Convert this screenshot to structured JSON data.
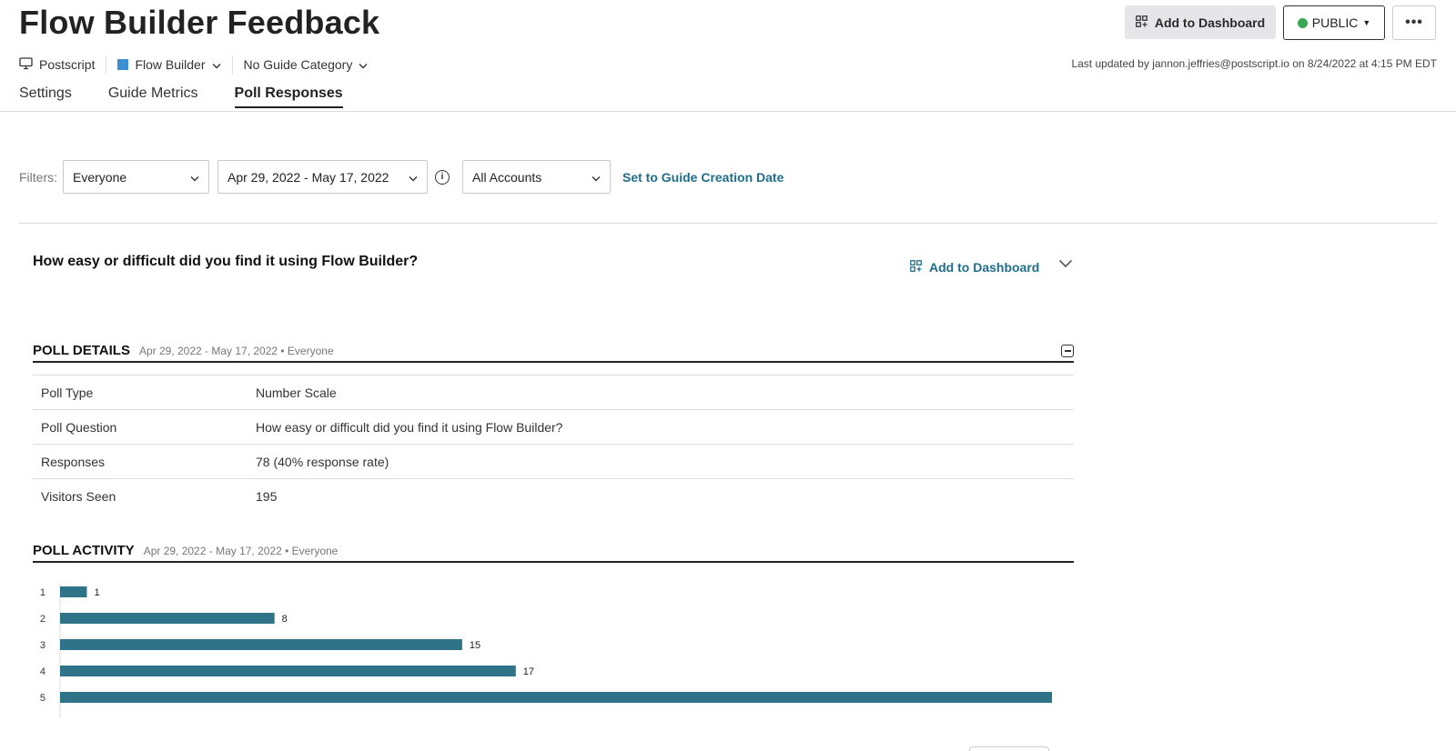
{
  "header": {
    "title": "Flow Builder Feedback",
    "add_dashboard_label": "Add to Dashboard",
    "public_label": "PUBLIC",
    "more_label": "•••",
    "status_color": "#3aa757"
  },
  "meta": {
    "app_label": "Postscript",
    "product_label": "Flow Builder",
    "product_color": "#3b8fd1",
    "category_label": "No Guide Category",
    "last_updated": "Last updated by jannon.jeffries@postscript.io on 8/24/2022 at 4:15 PM EDT"
  },
  "tabs": [
    {
      "label": "Settings",
      "active": false
    },
    {
      "label": "Guide Metrics",
      "active": false
    },
    {
      "label": "Poll Responses",
      "active": true
    }
  ],
  "filters": {
    "label": "Filters:",
    "segment": "Everyone",
    "date_range": "Apr 29, 2022 - May 17, 2022",
    "accounts": "All Accounts",
    "set_creation_label": "Set to Guide Creation Date"
  },
  "poll": {
    "question": "How easy or difficult did you find it using Flow Builder?",
    "add_dashboard_label": "Add to Dashboard",
    "accent_color": "#1f6e8c"
  },
  "details": {
    "title": "POLL DETAILS",
    "subtitle": "Apr 29, 2022 - May 17, 2022 • Everyone",
    "rows": [
      {
        "key": "Poll Type",
        "value": "Number Scale"
      },
      {
        "key": "Poll Question",
        "value": "How easy or difficult did you find it using Flow Builder?"
      },
      {
        "key": "Responses",
        "value": "78 (40% response rate)"
      },
      {
        "key": "Visitors Seen",
        "value": "195"
      }
    ]
  },
  "activity": {
    "title": "POLL ACTIVITY",
    "subtitle": "Apr 29, 2022 - May 17, 2022 • Everyone"
  },
  "chart_data": {
    "type": "bar",
    "orientation": "horizontal",
    "categories": [
      "1",
      "2",
      "3",
      "4",
      "5"
    ],
    "values": [
      1,
      8,
      15,
      17,
      37
    ],
    "value_labels": [
      "1",
      "8",
      "15",
      "17",
      ""
    ],
    "bar_color": "#2f7389",
    "xlim": [
      0,
      37
    ]
  }
}
